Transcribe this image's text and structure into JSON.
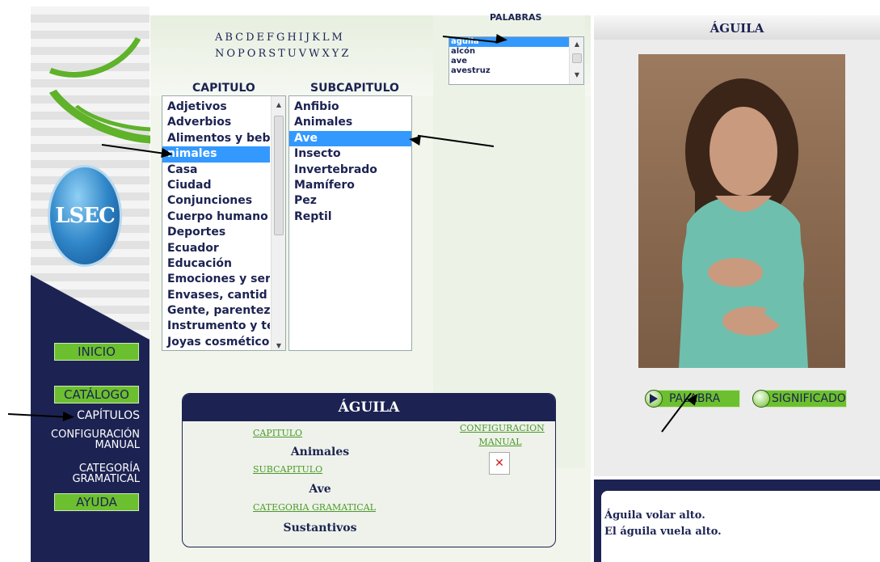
{
  "alphabet": {
    "row1": "ABCDEFGHIJKLM",
    "row2": "NOPORSTUVWXYZ"
  },
  "words": {
    "header": "PALABRAS",
    "items": [
      "águila",
      "alcón",
      "ave",
      "avestruz"
    ],
    "selected": "águila"
  },
  "chapters": {
    "header": "CAPITULO",
    "items": [
      "Adjetivos",
      "Adverbios",
      "Alimentos y beb",
      "Animales",
      "Casa",
      "Ciudad",
      "Conjunciones",
      "Cuerpo humano",
      "Deportes",
      "Ecuador",
      "Educación",
      "Emociones y ser",
      "Envases, cantid",
      "Gente, parentez",
      "Instrumento y te",
      "Joyas cosmético"
    ],
    "selected": "Animales",
    "selected_visible_text": "nimales"
  },
  "subchapters": {
    "header": "SUBCAPITULO",
    "items": [
      "Anfibio",
      "Animales",
      "Ave",
      "Insecto",
      "Invertebrado",
      "Mamífero",
      "Pez",
      "Reptil"
    ],
    "selected": "Ave"
  },
  "logo": {
    "text": "LSEC"
  },
  "nav": {
    "inicio": "INICIO",
    "catalogo": "CATÁLOGO",
    "capitulos": "CAPÍTULOS",
    "configuracion_l1": "CONFIGURACIÓN",
    "configuracion_l2": "MANUAL",
    "categoria_l1": "CATEGORÍA",
    "categoria_l2": "GRAMATICAL",
    "ayuda": "AYUDA"
  },
  "info": {
    "title": "ÁGUILA",
    "capitulo_label": "CAPITULO",
    "capitulo_value": "Animales",
    "subcapitulo_label": "SUBCAPITULO",
    "subcapitulo_value": "Ave",
    "categoria_label": "CATEGORIA GRAMATICAL",
    "categoria_value": "Sustantivos",
    "configuracion_label_l1": "CONFIGURACION",
    "configuracion_label_l2": "MANUAL"
  },
  "video": {
    "title": "ÁGUILA",
    "palabra_button": "PALABRA",
    "significado_button": "SIGNIFICADO"
  },
  "sentences": {
    "line1": "Águila volar alto.",
    "line2": "El águila vuela alto."
  },
  "colors": {
    "navy": "#1c2352",
    "green": "#6cbf2e",
    "selection": "#3399ff",
    "link_green": "#4c9a2a"
  }
}
